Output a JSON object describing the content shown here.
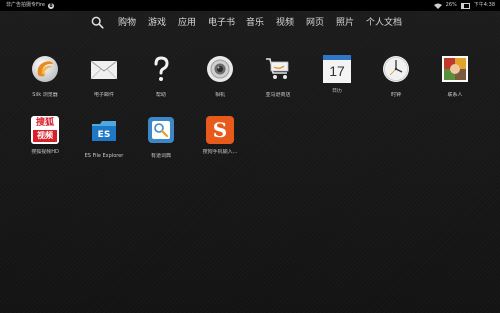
{
  "status_bar": {
    "carrier": "非广告拍摄专Fire",
    "notification_count": "8",
    "battery": "26%",
    "time": "下午4:38"
  },
  "nav": {
    "items": [
      "购物",
      "游戏",
      "应用",
      "电子书",
      "音乐",
      "视频",
      "网页",
      "照片",
      "个人文档"
    ]
  },
  "apps": [
    {
      "label": "Silk 浏览器",
      "icon": "silk-browser-icon"
    },
    {
      "label": "电子邮件",
      "icon": "email-envelope-icon"
    },
    {
      "label": "帮助",
      "icon": "help-question-icon"
    },
    {
      "label": "相机",
      "icon": "camera-lens-icon"
    },
    {
      "label": "亚马逊商店",
      "icon": "shopping-cart-icon"
    },
    {
      "label": "日历",
      "icon": "calendar-icon"
    },
    {
      "label": "时钟",
      "icon": "clock-icon"
    },
    {
      "label": "联系人",
      "icon": "contacts-icon"
    },
    {
      "label": "搜狐视频HD",
      "icon": "sohu-video-icon"
    },
    {
      "label": "ES File Explorer",
      "icon": "es-file-explorer-icon"
    },
    {
      "label": "有道词典",
      "icon": "youdao-dictionary-icon"
    },
    {
      "label": "搜狗手机输入...",
      "icon": "sogou-input-icon"
    }
  ],
  "calendar_day": "17",
  "sohu_text": [
    "搜狐",
    "视频"
  ],
  "es_text": "ES",
  "sogou_text": "S",
  "colors": {
    "statusbar_bg": "#000000",
    "background": "#161616",
    "text": "#d9d9d9"
  }
}
